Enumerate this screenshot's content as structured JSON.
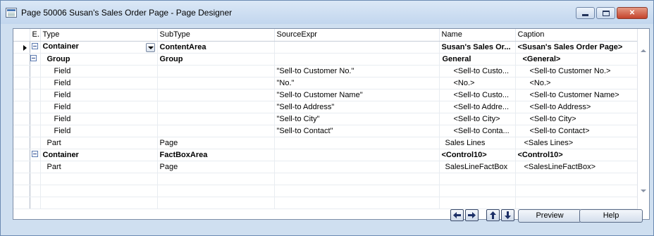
{
  "window": {
    "title": "Page 50006 Susan's Sales Order Page - Page Designer",
    "controls": {
      "minimize": "minimize",
      "maximize": "maximize",
      "close": "close-x"
    }
  },
  "grid": {
    "columns": {
      "enabled": "E..",
      "type": "Type",
      "subtype": "SubType",
      "source": "SourceExpr",
      "name": "Name",
      "caption": "Caption"
    },
    "rows": [
      {
        "type": "Container",
        "subtype": "ContentArea",
        "source": "",
        "name": "Susan's Sales Or...",
        "caption": "<Susan's Sales Order Page>",
        "bold": true,
        "toggle": true,
        "level": 0,
        "selected": true,
        "dropdown": true
      },
      {
        "type": "Group",
        "subtype": "Group",
        "source": "",
        "name": "General",
        "caption": "<General>",
        "bold": true,
        "toggle": true,
        "level": 1
      },
      {
        "type": "Field",
        "subtype": "",
        "source": "\"Sell-to Customer No.\"",
        "name": "<Sell-to Custo...",
        "caption": "<Sell-to Customer No.>",
        "level": 2
      },
      {
        "type": "Field",
        "subtype": "",
        "source": "\"No.\"",
        "name": "<No.>",
        "caption": "<No.>",
        "level": 2
      },
      {
        "type": "Field",
        "subtype": "",
        "source": "\"Sell-to Customer Name\"",
        "name": "<Sell-to Custo...",
        "caption": "<Sell-to Customer Name>",
        "level": 2
      },
      {
        "type": "Field",
        "subtype": "",
        "source": "\"Sell-to Address\"",
        "name": "<Sell-to Addre...",
        "caption": "<Sell-to Address>",
        "level": 2
      },
      {
        "type": "Field",
        "subtype": "",
        "source": "\"Sell-to City\"",
        "name": "<Sell-to City>",
        "caption": "<Sell-to City>",
        "level": 2
      },
      {
        "type": "Field",
        "subtype": "",
        "source": "\"Sell-to Contact\"",
        "name": "<Sell-to Conta...",
        "caption": "<Sell-to Contact>",
        "level": 2
      },
      {
        "type": "Part",
        "subtype": "Page",
        "source": "",
        "name": "Sales Lines",
        "caption": "<Sales Lines>",
        "level": 1
      },
      {
        "type": "Container",
        "subtype": "FactBoxArea",
        "source": "",
        "name": "<Control10>",
        "caption": "<Control10>",
        "bold": true,
        "toggle": true,
        "level": 0
      },
      {
        "type": "Part",
        "subtype": "Page",
        "source": "",
        "name": "SalesLineFactBox",
        "caption": "<SalesLineFactBox>",
        "level": 1
      }
    ],
    "empty_rows": 3
  },
  "footer": {
    "nav": [
      "move-left",
      "move-right",
      "move-up",
      "move-down"
    ],
    "preview_label": "Preview",
    "help_label": "Help"
  }
}
